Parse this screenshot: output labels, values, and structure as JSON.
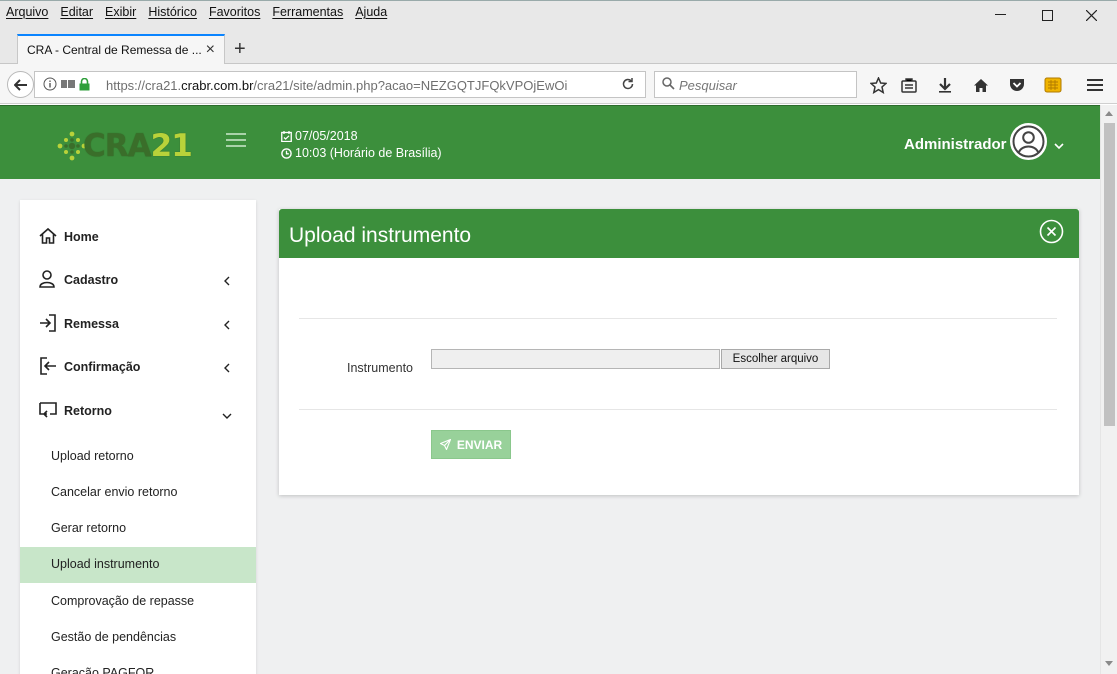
{
  "browser": {
    "menu": [
      "Arquivo",
      "Editar",
      "Exibir",
      "Histórico",
      "Favoritos",
      "Ferramentas",
      "Ajuda"
    ],
    "tab_title": "CRA - Central de Remessa de ...",
    "url_prefix": "https://cra21.",
    "url_host": "crabr.com.br",
    "url_path": "/cra21/site/admin.php?acao=NEZGQTJFQkVPOjEwOi",
    "search_placeholder": "Pesquisar"
  },
  "header": {
    "logo_text": "CRA",
    "logo_number": "21",
    "date": "07/05/2018",
    "time": "10:03 (Horário de Brasília)",
    "user_name": "Administrador"
  },
  "sidebar": {
    "items": [
      {
        "label": "Home",
        "icon": "home-icon"
      },
      {
        "label": "Cadastro",
        "icon": "user-icon"
      },
      {
        "label": "Remessa",
        "icon": "sign-in-icon"
      },
      {
        "label": "Confirmação",
        "icon": "sign-out-icon"
      },
      {
        "label": "Retorno",
        "icon": "return-icon"
      }
    ],
    "sub_items": [
      {
        "label": "Upload retorno"
      },
      {
        "label": "Cancelar envio retorno"
      },
      {
        "label": "Gerar retorno"
      },
      {
        "label": "Upload instrumento",
        "active": true
      },
      {
        "label": "Comprovação de repasse"
      },
      {
        "label": "Gestão de pendências"
      },
      {
        "label": "Geração PAGFOR"
      }
    ]
  },
  "panel": {
    "title": "Upload instrumento",
    "field_label": "Instrumento",
    "file_button": "Escolher arquivo",
    "submit_label": "ENVIAR"
  },
  "colors": {
    "brand_green": "#3c8f3c",
    "active_item": "#c8e6c9",
    "submit_disabled": "#98d19a"
  }
}
